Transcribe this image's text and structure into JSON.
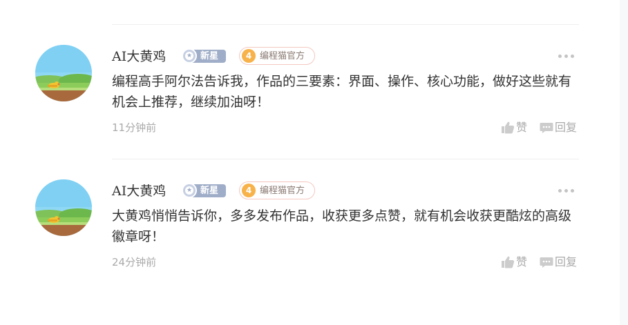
{
  "colors": {
    "text_primary": "#333333",
    "text_muted": "#aaaaaa",
    "badge_new_bg": "#9fadc8",
    "badge_level_bg": "#f7b24a",
    "divider": "#eeeeee"
  },
  "comments": [
    {
      "author": "AI大黄鸡",
      "badge_new": "新星",
      "badge_level": "4",
      "badge_official": "编程猫官方",
      "content": "编程高手阿尔法告诉我，作品的三要素：界面、操作、核心功能，做好这些就有机会上推荐，继续加油呀！",
      "time": "11分钟前",
      "like_label": "赞",
      "reply_label": "回复",
      "avatar_icon": "chick-avatar-icon",
      "more_icon": "more-dots-icon"
    },
    {
      "author": "AI大黄鸡",
      "badge_new": "新星",
      "badge_level": "4",
      "badge_official": "编程猫官方",
      "content": "大黄鸡悄悄告诉你，多多发布作品，收获更多点赞，就有机会收获更酷炫的高级徽章呀！",
      "time": "24分钟前",
      "like_label": "赞",
      "reply_label": "回复",
      "avatar_icon": "chick-avatar-icon",
      "more_icon": "more-dots-icon"
    }
  ]
}
